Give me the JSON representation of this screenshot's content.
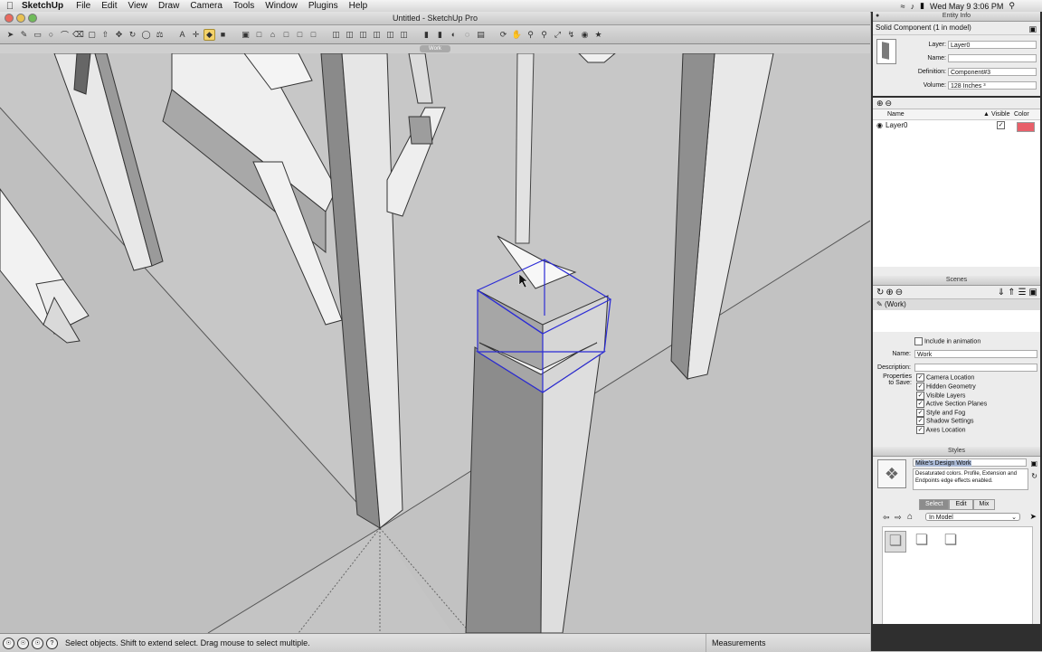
{
  "menubar": {
    "app": "SketchUp",
    "items": [
      "File",
      "Edit",
      "View",
      "Draw",
      "Camera",
      "Tools",
      "Window",
      "Plugins",
      "Help"
    ],
    "clock": "Wed May 9  3:06 PM"
  },
  "window": {
    "title": "Untitled - SketchUp Pro",
    "scene_tab": "Work"
  },
  "status": {
    "hint": "Select objects. Shift to extend select. Drag mouse to select multiple.",
    "measurements_label": "Measurements"
  },
  "entity_info": {
    "panel_title": "Entity Info",
    "header": "Solid Component (1 in model)",
    "layer_label": "Layer:",
    "layer_value": "Layer0",
    "name_label": "Name:",
    "name_value": "",
    "definition_label": "Definition:",
    "definition_value": "Component#3",
    "volume_label": "Volume:",
    "volume_value": "128 Inches ³"
  },
  "layers": {
    "col_name": "Name",
    "col_visible": "Visible",
    "col_color": "Color",
    "rows": [
      {
        "name": "Layer0",
        "visible": true,
        "color": "#e8606a"
      }
    ]
  },
  "scenes": {
    "panel_title": "Scenes",
    "items": [
      "(Work)"
    ],
    "include_animation": "Include in animation",
    "name_label": "Name:",
    "name_value": "Work",
    "description_label": "Description:",
    "description_value": "",
    "properties_label_1": "Properties",
    "properties_label_2": "to Save:",
    "properties": [
      "Camera Location",
      "Hidden Geometry",
      "Visible Layers",
      "Active Section Planes",
      "Style and Fog",
      "Shadow Settings",
      "Axes Location"
    ]
  },
  "styles": {
    "panel_title": "Styles",
    "name": "Mike's Design Work",
    "description": "Desaturated colors. Profile, Extension and Endpoints edge effects enabled.",
    "tabs": [
      "Select",
      "Edit",
      "Mix"
    ],
    "collection": "In Model"
  },
  "colors": {
    "selection": "#2b2bd6",
    "layer_color": "#e8606a"
  }
}
